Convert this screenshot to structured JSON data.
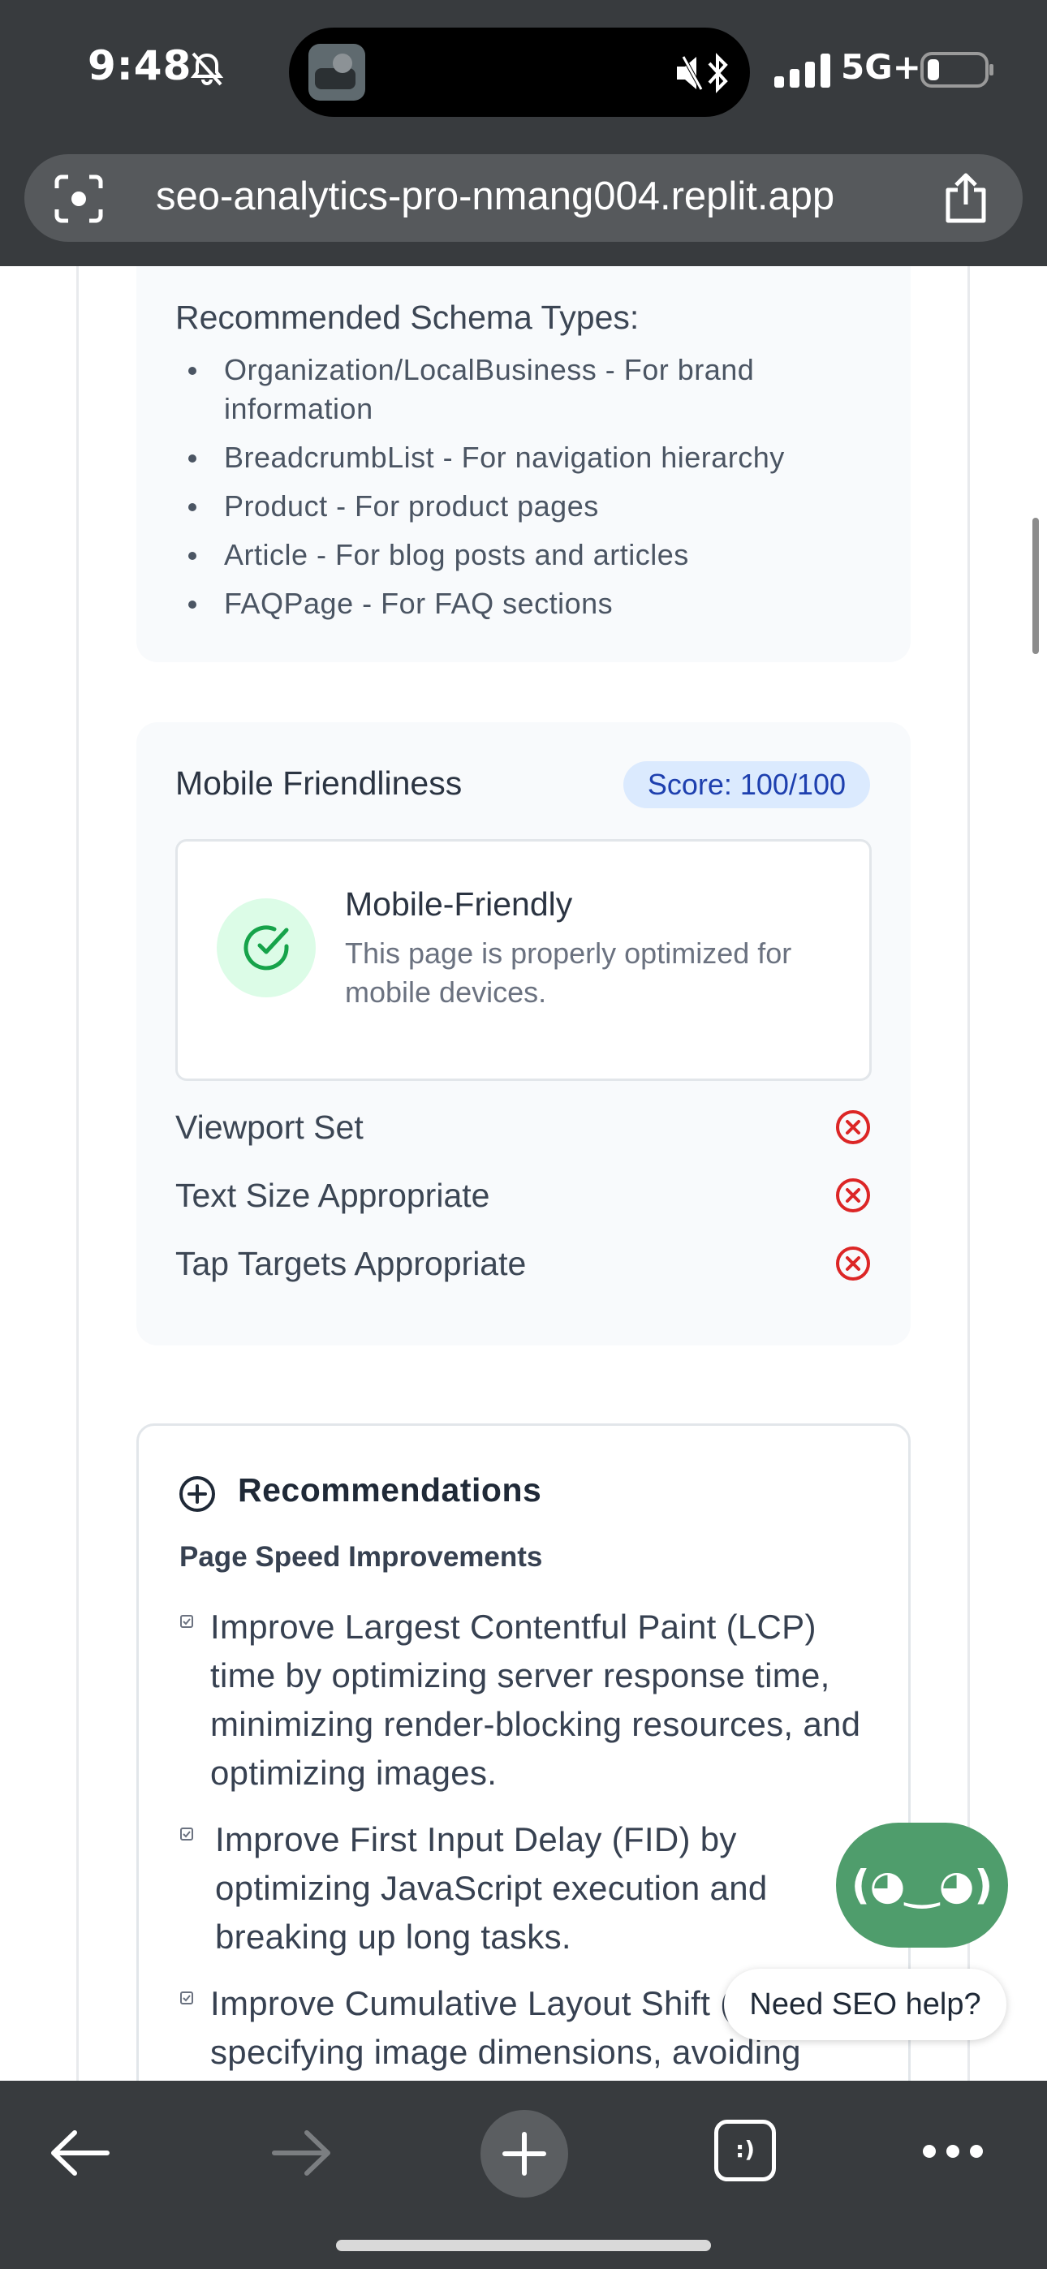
{
  "status_bar": {
    "time": "9:48",
    "network": "5G+"
  },
  "browser": {
    "url": "seo-analytics-pro-nmang004.replit.app"
  },
  "schema": {
    "title": "Recommended Schema Types:",
    "items": [
      "Organization/LocalBusiness - For brand information",
      "BreadcrumbList - For navigation hierarchy",
      "Product - For product pages",
      "Article - For blog posts and articles",
      "FAQPage - For FAQ sections"
    ]
  },
  "mobile": {
    "title": "Mobile Friendliness",
    "score": "Score: 100/100",
    "status_title": "Mobile-Friendly",
    "status_desc": "This page is properly optimized for mobile devices.",
    "checks": [
      "Viewport Set",
      "Text Size Appropriate",
      "Tap Targets Appropriate"
    ]
  },
  "recommendations": {
    "title": "Recommendations",
    "section": "Page Speed Improvements",
    "items": [
      "Improve Largest Contentful Paint (LCP) time by optimizing server response time, minimizing render-blocking resources, and optimizing images.",
      "Improve First Input Delay (FID) by optimizing JavaScript execution and breaking up long tasks.",
      "Improve Cumulative Layout Shift (CLS) by specifying image dimensions, avoiding dynamically injected content, and using"
    ]
  },
  "help": {
    "bot_face": "(◕‿◕)",
    "bubble": "Need SEO help?"
  },
  "toolbar": {
    "tabs_label": ":)"
  },
  "colors": {
    "accent_green": "#4f9d6c",
    "badge_blue": "#1e40af",
    "error_red": "#dc2626"
  }
}
